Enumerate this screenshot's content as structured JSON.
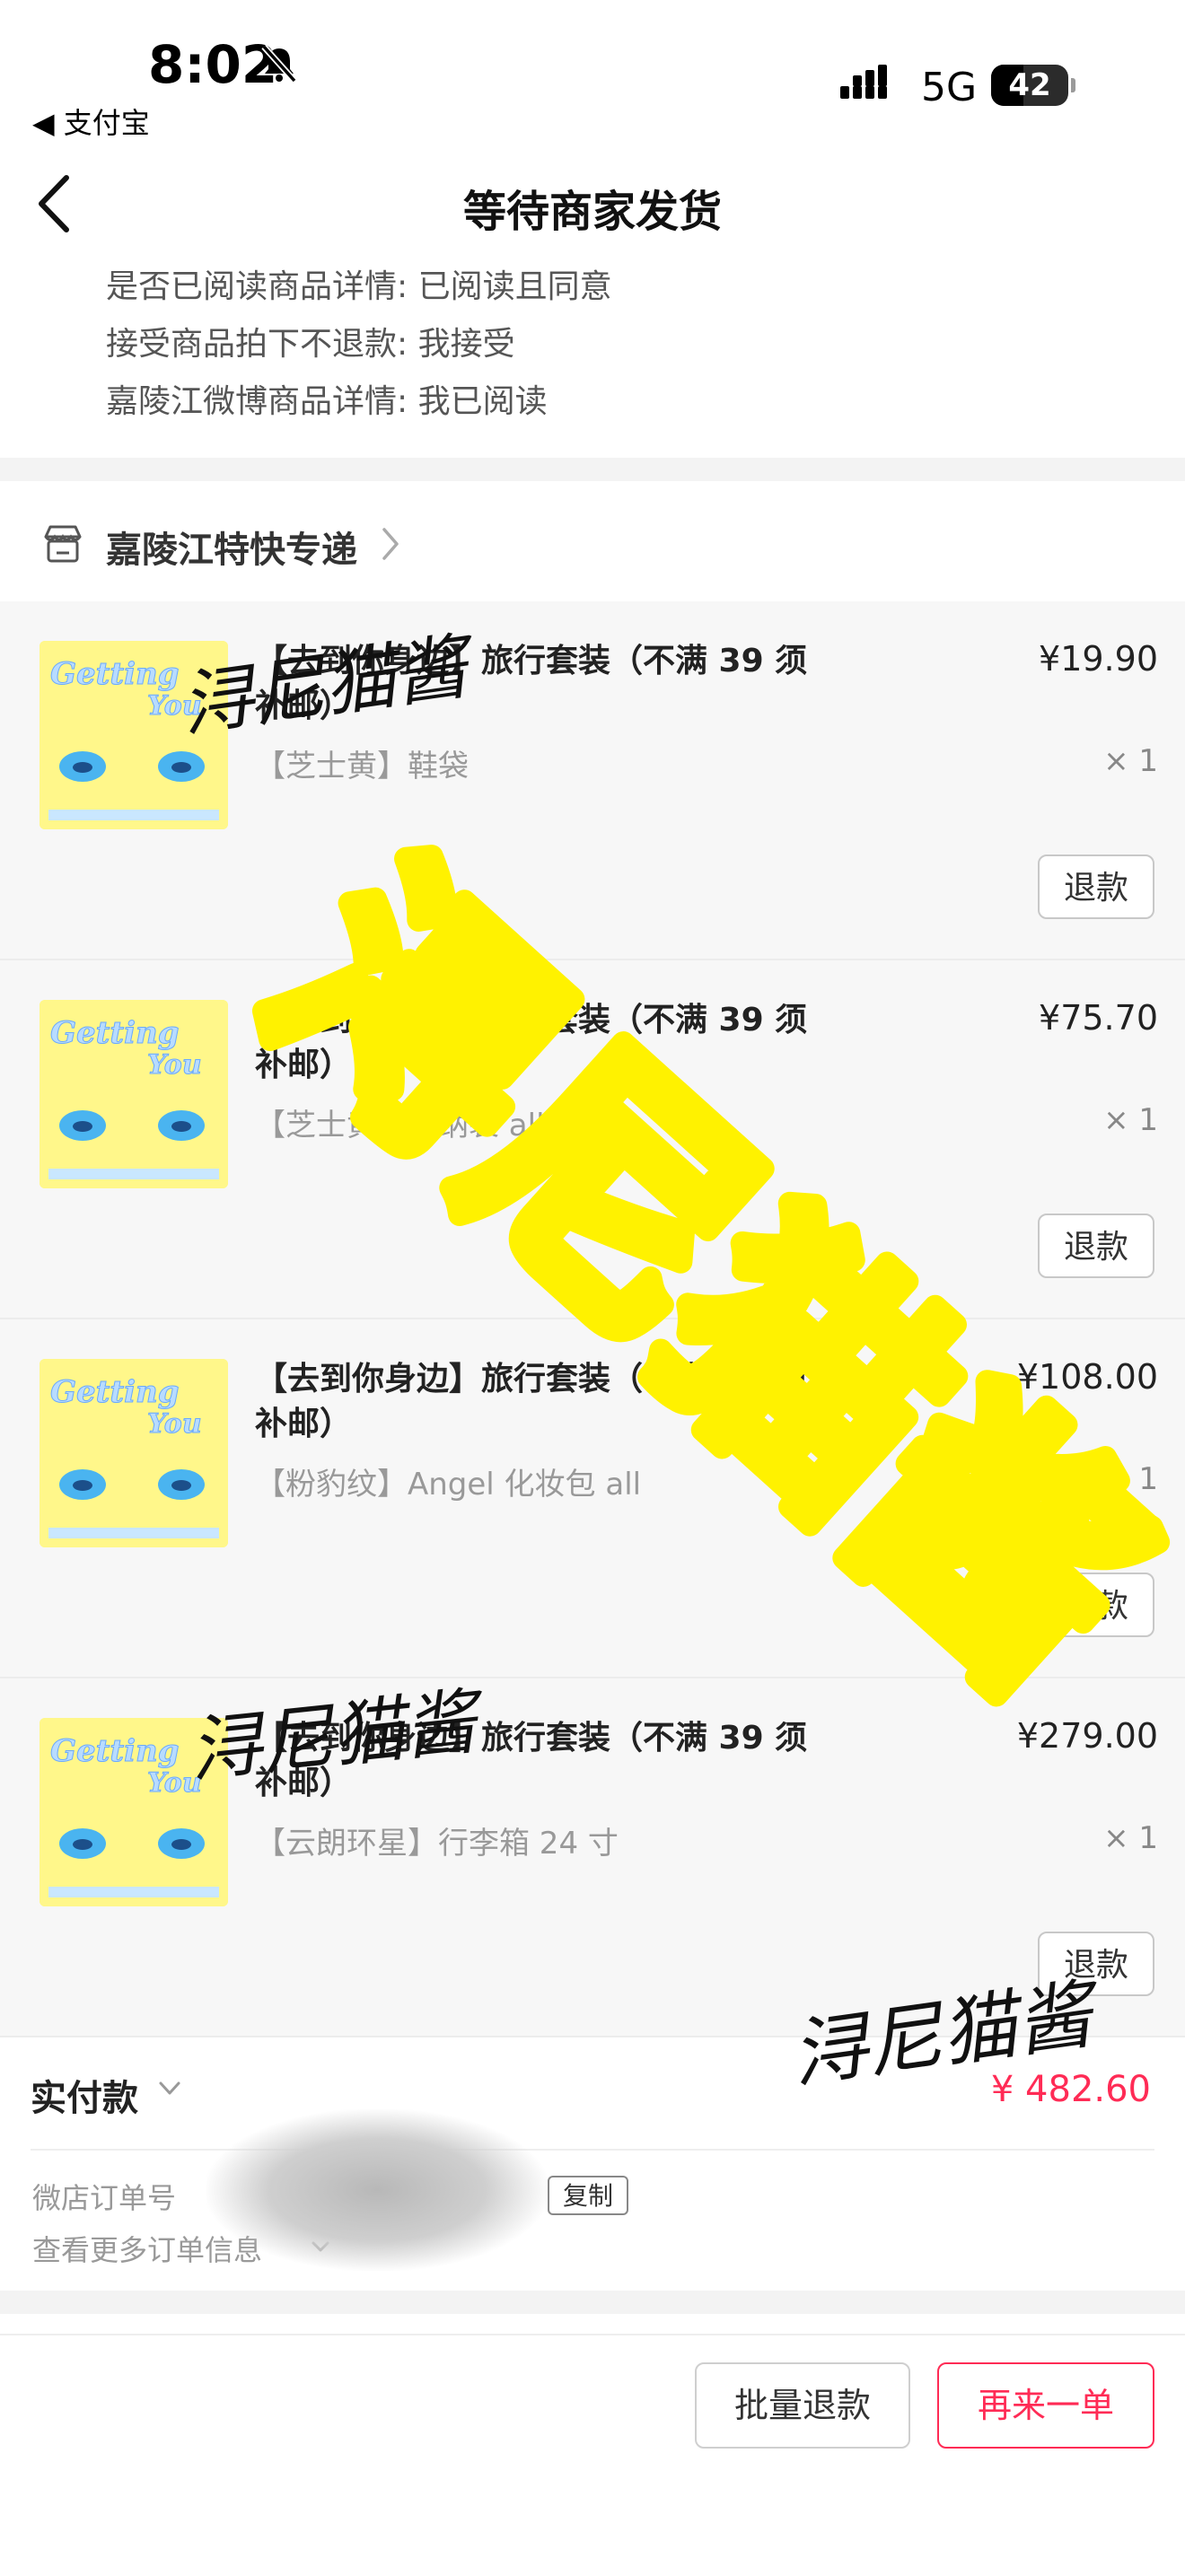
{
  "status_bar": {
    "time": "8:02",
    "back_app": "◀ 支付宝",
    "network": "5G",
    "battery": "42",
    "battery_level": 0.42
  },
  "nav": {
    "title": "等待商家发货"
  },
  "order_notes": [
    "是否已阅读商品详情: 已阅读且同意",
    "接受商品拍下不退款: 我接受",
    "嘉陵江微博商品详情: 我已阅读"
  ],
  "shop": {
    "name": "嘉陵江特快专递"
  },
  "items": [
    {
      "title": "【去到你身边】旅行套装（不满 39 须补邮）",
      "variant": "【芝士黄】鞋袋",
      "price": "¥19.90",
      "qty": "× 1",
      "refund_label": "退款"
    },
    {
      "title": "【去到你身边】旅行套装（不满 39 须补邮）",
      "variant": "【芝士黄】收纳袋 all",
      "price": "¥75.70",
      "qty": "× 1",
      "refund_label": "退款"
    },
    {
      "title": "【去到你身边】旅行套装（不满 39 须补邮）",
      "variant": "【粉豹纹】Angel 化妆包 all",
      "price": "¥108.00",
      "qty": "× 1",
      "refund_label": "退款"
    },
    {
      "title": "【去到你身边】旅行套装（不满 39 须补邮）",
      "variant": "【云朗环星】行李箱 24 寸",
      "price": "¥279.00",
      "qty": "× 1",
      "refund_label": "退款"
    }
  ],
  "summary": {
    "paid_label": "实付款",
    "paid_amount": "¥ 482.60",
    "order_no_label": "微店订单号",
    "copy_label": "复制",
    "more_info_label": "查看更多订单信息"
  },
  "footer": {
    "batch_refund": "批量退款",
    "reorder": "再来一单"
  },
  "watermarks": {
    "signature": "浔尼猫酱",
    "large": "浔尼猫酱"
  },
  "colors": {
    "accent": "#ff2b55",
    "thumb_bg": "#fff78a",
    "watermark_yellow": "#fff200"
  },
  "icons": {
    "mute": "bell-slash-icon",
    "back": "chevron-left-icon",
    "shop": "store-icon"
  }
}
